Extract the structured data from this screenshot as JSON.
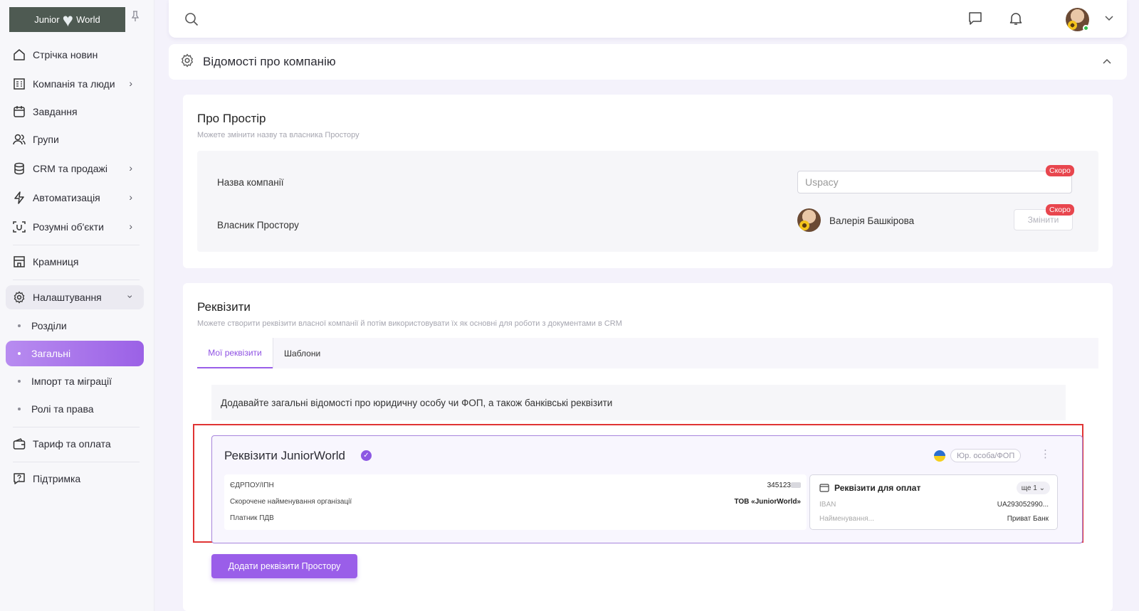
{
  "app": {
    "logo_left": "Junior",
    "logo_right": "World"
  },
  "sidebar": {
    "items": [
      {
        "label": "Стрічка новин",
        "icon": "home-icon"
      },
      {
        "label": "Компанія та люди",
        "icon": "building-icon"
      },
      {
        "label": "Завдання",
        "icon": "calendar-icon"
      },
      {
        "label": "Групи",
        "icon": "users-icon"
      },
      {
        "label": "CRM та продажі",
        "icon": "database-icon"
      },
      {
        "label": "Автоматизація",
        "icon": "lightning-icon"
      },
      {
        "label": "Розумні об'єкти",
        "icon": "scan-icon"
      },
      {
        "label": "Крамниця",
        "icon": "store-icon"
      },
      {
        "label": "Налаштування",
        "icon": "gear-icon"
      }
    ],
    "sub_items": [
      "Розділи",
      "Загальні",
      "Імпорт та міграції",
      "Ролі та права"
    ],
    "bottom_items": [
      {
        "label": "Тариф та оплата",
        "icon": "wallet-icon"
      },
      {
        "label": "Підтримка",
        "icon": "help-icon"
      }
    ]
  },
  "topbar": {
    "search_placeholder": ""
  },
  "section": {
    "title": "Відомості про компанію"
  },
  "about": {
    "title": "Про Простір",
    "subtitle": "Можете змінити назву та власника Простору",
    "company_label": "Назва компанії",
    "company_value": "Uspacy",
    "owner_label": "Власник Простору",
    "owner_name": "Валерія Башкірова",
    "change_label": "Змінити",
    "soon_badge": "Скоро"
  },
  "requisites": {
    "title": "Реквізити",
    "subtitle": "Можете створити реквізити власної компанії й потім використовувати їх як основні для роботи з документами в CRM",
    "tabs": [
      "Мої реквізити",
      "Шаблони"
    ],
    "info": "Додавайте загальні відомості про юридичну особу чи ФОП, а також банківські реквізити",
    "card": {
      "title": "Реквізити JuniorWorld",
      "entity_type": "Юр. особа/ФОП",
      "fields": [
        {
          "label": "ЄДРПОУ/ІПН",
          "value": "345123"
        },
        {
          "label": "Скорочене найменування організації",
          "value": "ТОВ «JuniorWorld»"
        },
        {
          "label": "Платник ПДВ",
          "value": ""
        }
      ],
      "payment": {
        "title": "Реквізити для оплат",
        "more": "ще 1",
        "rows": [
          {
            "label": "IBAN",
            "value": "UA293052990..."
          },
          {
            "label": "Найменування...",
            "value": "Приват Банк"
          }
        ]
      }
    },
    "add_button": "Додати реквізити Простору"
  },
  "colors": {
    "accent": "#9a5ee9",
    "highlight": "#e03434",
    "badge": "#e8464e"
  }
}
